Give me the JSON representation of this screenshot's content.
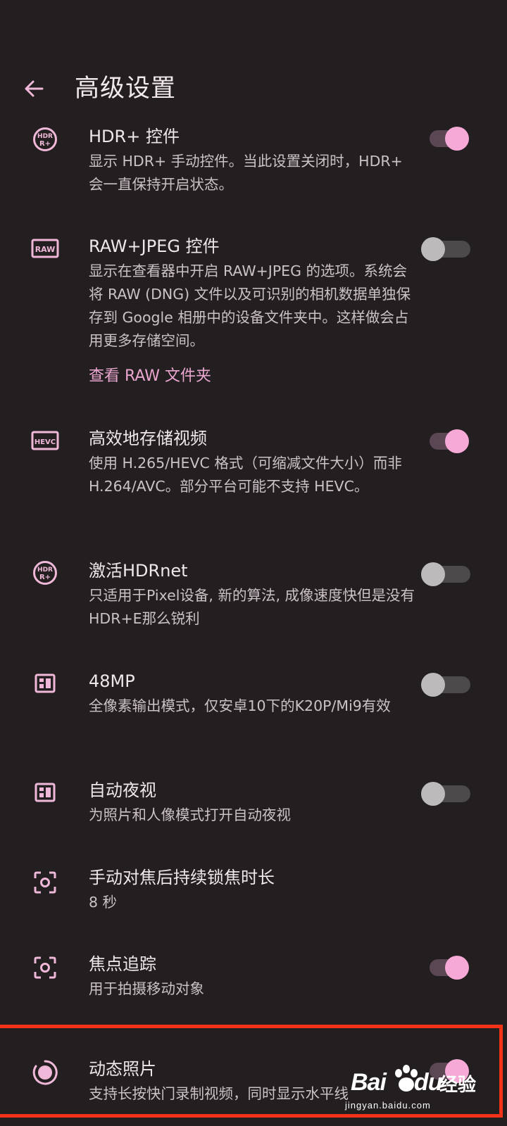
{
  "header": {
    "title": "高级设置",
    "back_icon": "arrow-back-icon"
  },
  "settings": [
    {
      "icon": "hdr-plus-icon",
      "title": "HDR+ 控件",
      "description": "显示 HDR+ 手动控件。当此设置关闭时，HDR+ 会一直保持开启状态。",
      "toggle": true
    },
    {
      "icon": "raw-icon",
      "title": "RAW+JPEG 控件",
      "description": "显示在查看器中开启 RAW+JPEG 的选项。系统会将 RAW (DNG) 文件以及可识别的相机数据单独保存到 Google 相册中的设备文件夹中。这样做会占用更多存储空间。",
      "link": "查看 RAW 文件夹",
      "toggle": false
    },
    {
      "icon": "hevc-icon",
      "title": "高效地存储视频",
      "description": "使用 H.265/HEVC 格式（可缩减文件大小）而非 H.264/AVC。部分平台可能不支持 HEVC。",
      "toggle": true
    },
    {
      "icon": "hdr-plus-icon",
      "title": "激活HDRnet",
      "description": "只适用于Pixel设备, 新的算法, 成像速度快但是没有HDR+E那么锐利",
      "toggle": false
    },
    {
      "icon": "sensor-icon",
      "title": "48MP",
      "description": "全像素输出模式，仅安卓10下的K20P/Mi9有效",
      "toggle": false
    },
    {
      "icon": "sensor-icon",
      "title": "自动夜视",
      "description": "为照片和人像模式打开自动夜视",
      "toggle": false
    },
    {
      "icon": "focus-icon",
      "title": "手动对焦后持续锁焦时长",
      "description": "8 秒"
    },
    {
      "icon": "focus-icon",
      "title": "焦点追踪",
      "description": "用于拍摄移动对象",
      "toggle": true
    },
    {
      "icon": "motion-photo-icon",
      "title": "动态照片",
      "description": "支持长按快门录制视频，同时显示水平线",
      "toggle": true
    }
  ],
  "watermark": {
    "brand": "Bai",
    "brand_suffix": "du",
    "cn": "经验",
    "url": "jingyan.baidu.com"
  },
  "colors": {
    "background": "#231f20",
    "accent": "#f6a9d6",
    "link": "#eaa6cf",
    "highlight_border": "#f2331a"
  }
}
